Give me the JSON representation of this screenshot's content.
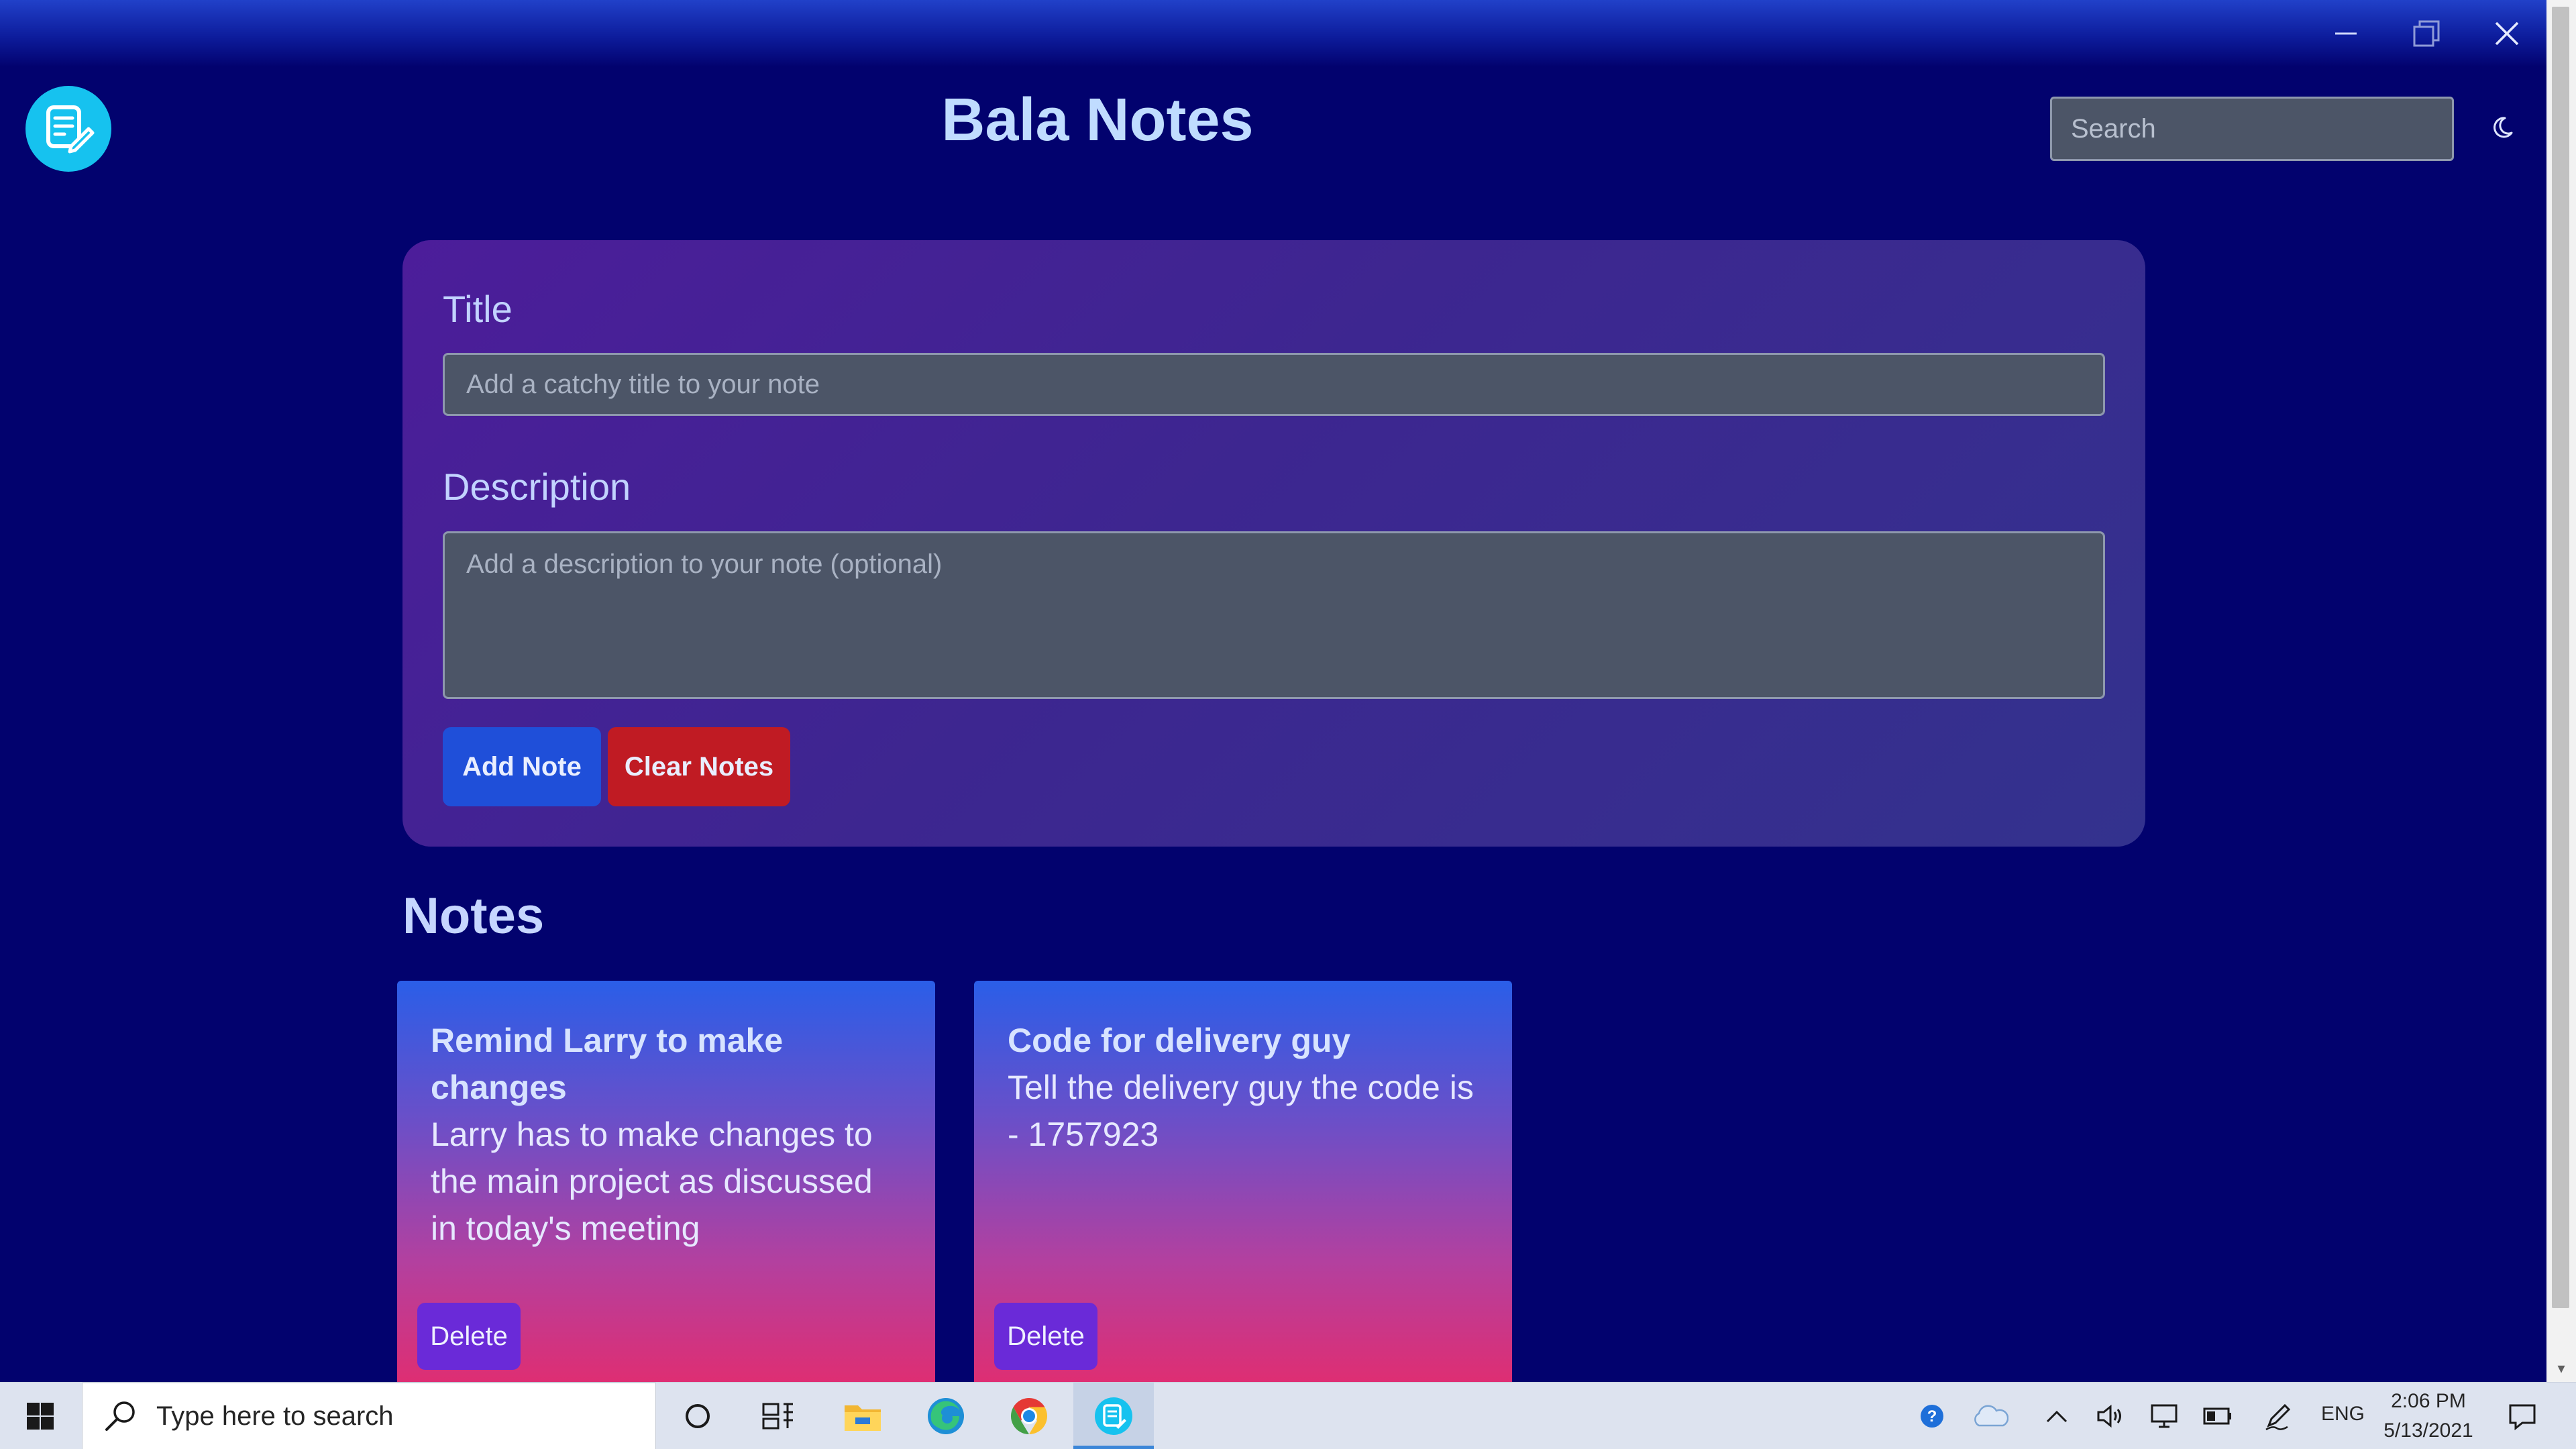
{
  "app": {
    "title": "Bala Notes",
    "search_placeholder": "Search"
  },
  "form": {
    "title_label": "Title",
    "title_placeholder": "Add a catchy title to your note",
    "description_label": "Description",
    "description_placeholder": "Add a description to your note (optional)",
    "add_button": "Add Note",
    "clear_button": "Clear Notes"
  },
  "notes": {
    "heading": "Notes",
    "delete_label": "Delete",
    "items": [
      {
        "title": "Remind Larry to make changes",
        "description": "Larry has to make changes to the main project as discussed in today's meeting"
      },
      {
        "title": "Code for delivery guy",
        "description": "Tell the delivery guy the code is - 1757923"
      }
    ]
  },
  "taskbar": {
    "search_placeholder": "Type here to search",
    "language": "ENG",
    "time": "2:06 PM",
    "date": "5/13/2021"
  },
  "colors": {
    "background": "#02026e",
    "add_button": "#1f4fd9",
    "clear_button": "#c01b23",
    "delete_button": "#6a2ad8",
    "logo": "#16c2ef"
  },
  "icons": [
    "app-logo-icon",
    "minimize-icon",
    "restore-icon",
    "close-icon",
    "moon-icon",
    "windows-start-icon",
    "search-icon",
    "cortana-icon",
    "task-view-icon",
    "file-explorer-icon",
    "edge-icon",
    "chrome-icon",
    "notes-app-icon",
    "help-icon",
    "onedrive-icon",
    "chevron-up-icon",
    "volume-icon",
    "display-icon",
    "battery-icon",
    "pen-icon",
    "notification-icon"
  ]
}
